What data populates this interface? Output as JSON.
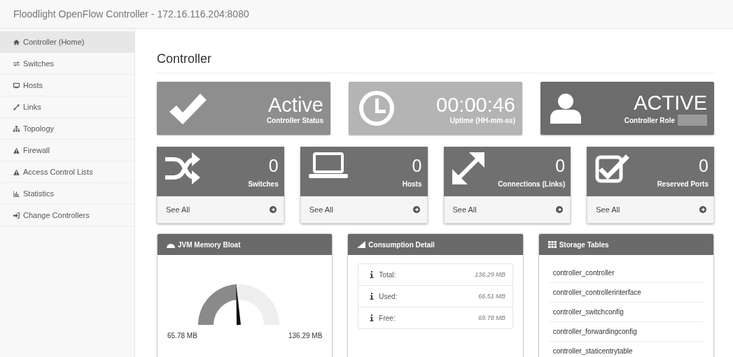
{
  "window": {
    "title": "Floodlight OpenFlow Controller - 172.16.116.204:8080"
  },
  "sidebar": {
    "items": [
      {
        "label": "Controller (Home)",
        "selected": true
      },
      {
        "label": "Switches",
        "selected": false
      },
      {
        "label": "Hosts",
        "selected": false
      },
      {
        "label": "Links",
        "selected": false
      },
      {
        "label": "Topology",
        "selected": false
      },
      {
        "label": "Firewall",
        "selected": false
      },
      {
        "label": "Access Control Lists",
        "selected": false
      },
      {
        "label": "Statistics",
        "selected": false
      },
      {
        "label": "Change Controllers",
        "selected": false
      }
    ]
  },
  "page_title": "Controller",
  "status_cards": [
    {
      "value": "Active",
      "label": "Controller Status",
      "color": "#8e8e8e"
    },
    {
      "value": "00:00:46",
      "label": "Uptime (HH-mm-ss)",
      "color": "#b4b4b4"
    },
    {
      "value": "ACTIVE",
      "label": "Controller Role",
      "color": "#6c6c6c"
    }
  ],
  "count_cards": [
    {
      "value": "0",
      "label": "Switches",
      "link": "See All"
    },
    {
      "value": "0",
      "label": "Hosts",
      "link": "See All"
    },
    {
      "value": "0",
      "label": "Connections (Links)",
      "link": "See All"
    },
    {
      "value": "0",
      "label": "Reserved Ports",
      "link": "See All"
    }
  ],
  "memory_panel": {
    "title": "JVM Memory Bloat",
    "min_label": "65.78 MB",
    "max_label": "136.29 MB"
  },
  "consumption_panel": {
    "title": "Consumption Detail",
    "rows": [
      {
        "label": "Total:",
        "value": "136.29 MB"
      },
      {
        "label": "Used:",
        "value": "66.51 MB"
      },
      {
        "label": "Free:",
        "value": "69.78 MB"
      }
    ]
  },
  "storage_panel": {
    "title": "Storage Tables",
    "items": [
      "controller_controller",
      "controller_controllerinterface",
      "controller_switchconfig",
      "controller_forwardingconfig",
      "controller_staticentrytable"
    ]
  }
}
